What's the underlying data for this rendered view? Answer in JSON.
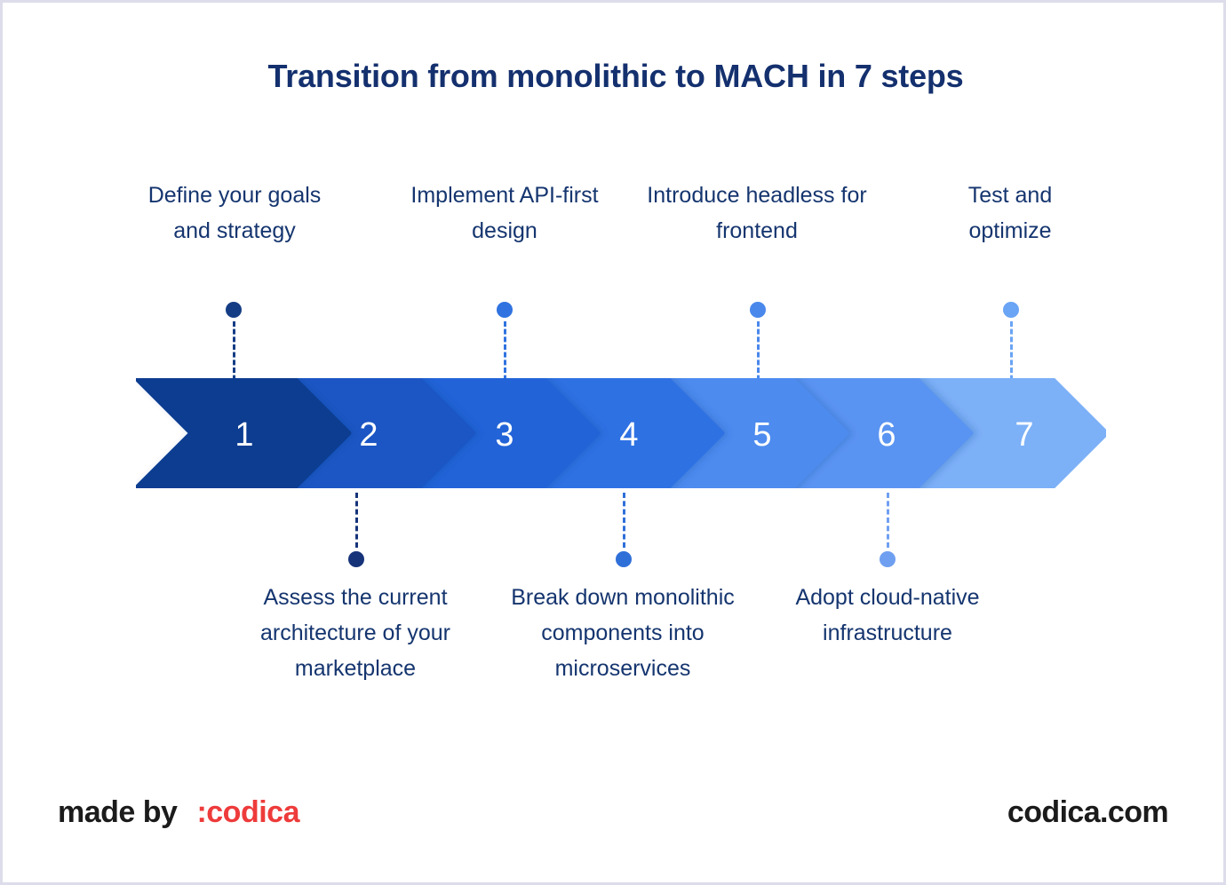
{
  "page": {
    "title": "Transition from monolithic to MACH in 7 steps",
    "background": "#ffffff",
    "border_color": "#dcdcea",
    "title_color": "#14306e",
    "label_color": "#15356f"
  },
  "steps": [
    {
      "number": "1",
      "label": "Define your goals and strategy",
      "position": "top",
      "color": "#0b3d91",
      "dot_color": "#153d85"
    },
    {
      "number": "2",
      "label": "Assess the current architecture of your marketplace",
      "position": "bottom",
      "color": "#1a56c4",
      "dot_color": "#16337a"
    },
    {
      "number": "3",
      "label": "Implement API-first design",
      "position": "top",
      "color": "#2163d8",
      "dot_color": "#3073e0"
    },
    {
      "number": "4",
      "label": "Break down monolithic components into microservices",
      "position": "bottom",
      "color": "#2f71e3",
      "dot_color": "#2f6fd8"
    },
    {
      "number": "5",
      "label": "Introduce headless for frontend",
      "position": "top",
      "color": "#4d8bef",
      "dot_color": "#4a88ec"
    },
    {
      "number": "6",
      "label": "Adopt cloud-native infrastructure",
      "position": "bottom",
      "color": "#5a94f2",
      "dot_color": "#6f9ff0"
    },
    {
      "number": "7",
      "label": "Test and optimize",
      "position": "top",
      "color": "#7cb0f7",
      "dot_color": "#6aa4f4"
    }
  ],
  "footer": {
    "made_by": "made by",
    "brand": ":codica",
    "website": "codica.com",
    "brand_color": "#ee3b3b",
    "text_color": "#1b1b1b"
  }
}
